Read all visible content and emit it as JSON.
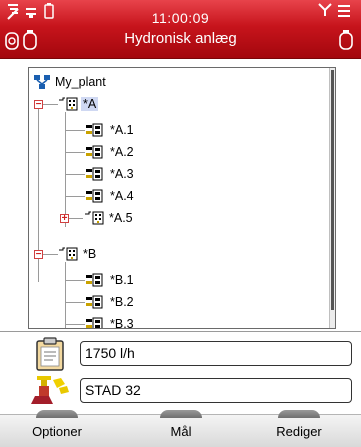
{
  "header": {
    "time": "11:00:09",
    "title": "Hydronisk anlæg",
    "icons": [
      "signal-sensor-icon",
      "menu-lines-icon",
      "battery-icon",
      "antenna-icon",
      "sensor-pair-icon",
      "device-icon"
    ]
  },
  "tree": {
    "root": "My_plant",
    "nodes": [
      {
        "label": "*A",
        "kind": "group",
        "expanded": true,
        "selected": true
      },
      {
        "label": "*A.1",
        "kind": "valve"
      },
      {
        "label": "*A.2",
        "kind": "valve"
      },
      {
        "label": "*A.3",
        "kind": "valve"
      },
      {
        "label": "*A.4",
        "kind": "valve"
      },
      {
        "label": "*A.5",
        "kind": "group",
        "expanded": false
      },
      {
        "label": "*B",
        "kind": "group",
        "expanded": true
      },
      {
        "label": "*B.1",
        "kind": "valve"
      },
      {
        "label": "*B.2",
        "kind": "valve"
      },
      {
        "label": "*B.3",
        "kind": "valve"
      }
    ]
  },
  "fields": {
    "flow_value": "1750 l/h",
    "valve_value": "STAD 32"
  },
  "softkeys": {
    "left": "Optioner",
    "middle": "Mål",
    "right": "Rediger"
  },
  "colors": {
    "header": "#c7141c",
    "selection": "#cfd8f2",
    "expander": "#d02020"
  }
}
